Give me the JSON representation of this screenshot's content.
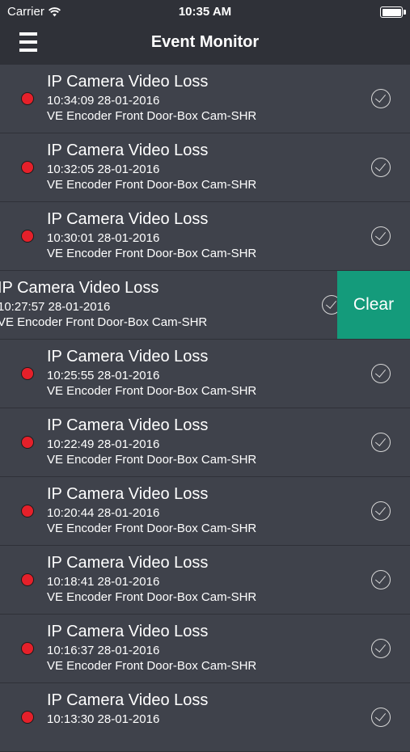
{
  "status_bar": {
    "carrier": "Carrier",
    "time": "10:35 AM",
    "battery_level": 1.0
  },
  "nav_bar": {
    "title": "Event Monitor",
    "menu_icon": "hamburger-menu-icon"
  },
  "events": [
    {
      "title": "IP Camera Video Loss",
      "timestamp": "10:34:09 28-01-2016",
      "source": "VE Encoder Front Door-Box Cam-SHR",
      "status_color": "#e5202a",
      "swiped": false
    },
    {
      "title": "IP Camera Video Loss",
      "timestamp": "10:32:05 28-01-2016",
      "source": "VE Encoder Front Door-Box Cam-SHR",
      "status_color": "#e5202a",
      "swiped": false
    },
    {
      "title": "IP Camera Video Loss",
      "timestamp": "10:30:01 28-01-2016",
      "source": "VE Encoder Front Door-Box Cam-SHR",
      "status_color": "#e5202a",
      "swiped": false
    },
    {
      "title": "IP Camera Video Loss",
      "timestamp": "10:27:57 28-01-2016",
      "source": "VE Encoder Front Door-Box Cam-SHR",
      "status_color": "#e5202a",
      "swiped": true,
      "action_label": "Clear",
      "action_color": "#149b7b"
    },
    {
      "title": "IP Camera Video Loss",
      "timestamp": "10:25:55 28-01-2016",
      "source": "VE Encoder Front Door-Box Cam-SHR",
      "status_color": "#e5202a",
      "swiped": false
    },
    {
      "title": "IP Camera Video Loss",
      "timestamp": "10:22:49 28-01-2016",
      "source": "VE Encoder Front Door-Box Cam-SHR",
      "status_color": "#e5202a",
      "swiped": false
    },
    {
      "title": "IP Camera Video Loss",
      "timestamp": "10:20:44 28-01-2016",
      "source": "VE Encoder Front Door-Box Cam-SHR",
      "status_color": "#e5202a",
      "swiped": false
    },
    {
      "title": "IP Camera Video Loss",
      "timestamp": "10:18:41 28-01-2016",
      "source": "VE Encoder Front Door-Box Cam-SHR",
      "status_color": "#e5202a",
      "swiped": false
    },
    {
      "title": "IP Camera Video Loss",
      "timestamp": "10:16:37 28-01-2016",
      "source": "VE Encoder Front Door-Box Cam-SHR",
      "status_color": "#e5202a",
      "swiped": false
    },
    {
      "title": "IP Camera Video Loss",
      "timestamp": "10:13:30 28-01-2016",
      "source": "",
      "status_color": "#e5202a",
      "swiped": false
    }
  ]
}
